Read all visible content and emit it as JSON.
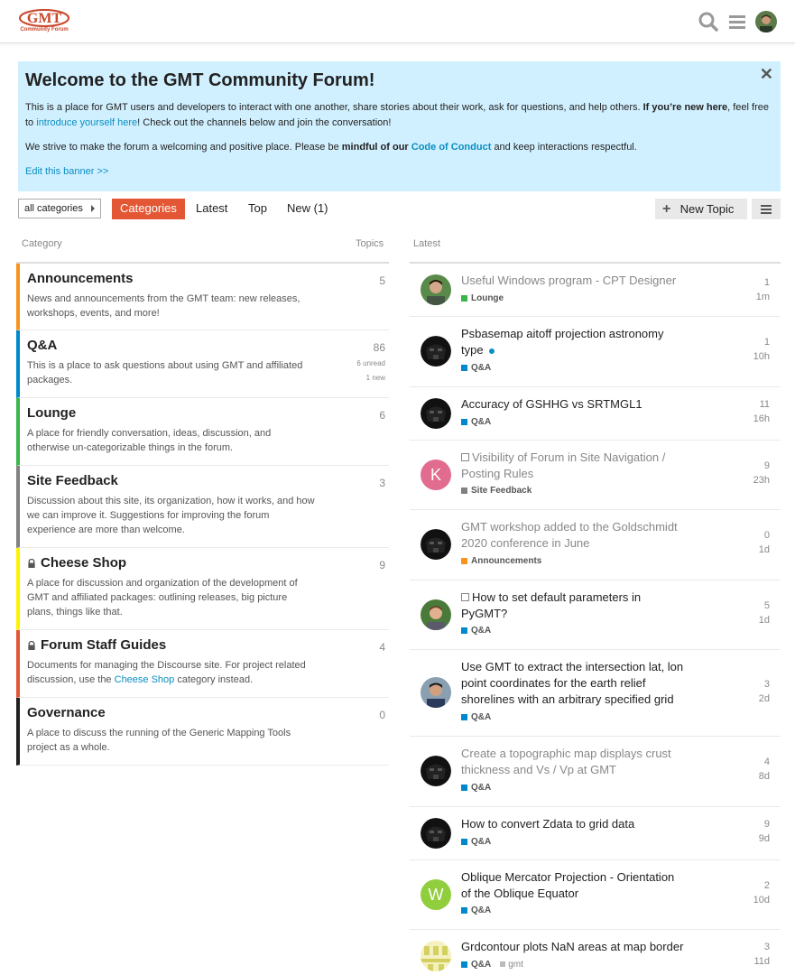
{
  "header": {
    "logo_text": "GMT",
    "logo_sub": "Community Forum"
  },
  "banner": {
    "title": "Welcome to the GMT Community Forum!",
    "p1_a": "This is a place for GMT users and developers to interact with one another, share stories about their work, ask for questions, and help others.",
    "p1_bold": "If you’re new here",
    "p1_b": ", feel free to",
    "p1_link": "introduce yourself here",
    "p1_c": "! Check out the channels below and join the conversation!",
    "p2_a": "We strive to make the forum a welcoming and positive place. Please be",
    "p2_bold": "mindful of our",
    "p2_link": "Code of Conduct",
    "p2_b": "and keep interactions respectful.",
    "edit_link": "Edit this banner >>",
    "close": "✕"
  },
  "nav": {
    "dropdown": "all categories",
    "categories": "Categories",
    "latest": "Latest",
    "top": "Top",
    "new": "New (1)",
    "new_topic": "New Topic"
  },
  "columns": {
    "category": "Category",
    "topics": "Topics",
    "latest": "Latest"
  },
  "categories": [
    {
      "name": "Announcements",
      "desc": "News and announcements from the GMT team: new releases, workshops, events, and more!",
      "count": "5",
      "color": "#f7941d"
    },
    {
      "name": "Q&A",
      "desc": "This is a place to ask questions about using GMT and affiliated packages.",
      "count": "86",
      "unread": "6 unread",
      "new": "1 new",
      "color": "#0088cc"
    },
    {
      "name": "Lounge",
      "desc": "A place for friendly conversation, ideas, discussion, and otherwise un-categorizable things in the forum.",
      "count": "6",
      "color": "#3ab54a"
    },
    {
      "name": "Site Feedback",
      "desc": "Discussion about this site, its organization, how it works, and how we can improve it. Suggestions for improving the forum experience are more than welcome.",
      "count": "3",
      "color": "#808281"
    },
    {
      "name": "Cheese Shop",
      "desc": "A place for discussion and organization of the development of GMT and affiliated packages: outlining releases, big picture plans, things like that.",
      "count": "9",
      "color": "#fff200"
    },
    {
      "name": "Forum Staff Guides",
      "desc_a": "Documents for managing the Discourse site. For project related discussion, use the",
      "desc_link": "Cheese Shop",
      "desc_b": "category instead.",
      "count": "4",
      "color": "#e45735"
    },
    {
      "name": "Governance",
      "desc": "A place to discuss the running of the Generic Mapping Tools project as a whole.",
      "count": "0",
      "color": "#231f20"
    }
  ],
  "topics": [
    {
      "title": "Useful Windows program - CPT Designer",
      "cat": "Lounge",
      "cat_color": "#3ab54a",
      "posts": "1",
      "age": "1m"
    },
    {
      "title": "Psbasemap aitoff projection astronomy type",
      "cat": "Q&A",
      "cat_color": "#0088cc",
      "posts": "1",
      "age": "10h"
    },
    {
      "title": "Accuracy of GSHHG vs SRTMGL1",
      "cat": "Q&A",
      "cat_color": "#0088cc",
      "posts": "11",
      "age": "16h"
    },
    {
      "title": "Visibility of Forum in Site Navigation / Posting Rules",
      "cat": "Site Feedback",
      "cat_color": "#808281",
      "posts": "9",
      "age": "23h",
      "avatar_letter": "K",
      "avatar_color": "#e16c8f"
    },
    {
      "title": "GMT workshop added to the Goldschmidt 2020 conference in June",
      "cat": "Announcements",
      "cat_color": "#f7941d",
      "posts": "0",
      "age": "1d"
    },
    {
      "title": "How to set default parameters in PyGMT?",
      "cat": "Q&A",
      "cat_color": "#0088cc",
      "posts": "5",
      "age": "1d"
    },
    {
      "title": "Use GMT to extract the intersection lat, lon point coordinates for the earth relief shorelines with an arbitrary specified grid",
      "cat": "Q&A",
      "cat_color": "#0088cc",
      "posts": "3",
      "age": "2d"
    },
    {
      "title": "Create a topographic map displays crust thickness and Vs / Vp at GMT",
      "cat": "Q&A",
      "cat_color": "#0088cc",
      "posts": "4",
      "age": "8d"
    },
    {
      "title": "How to convert Zdata to grid data",
      "cat": "Q&A",
      "cat_color": "#0088cc",
      "posts": "9",
      "age": "9d"
    },
    {
      "title": "Oblique Mercator Projection - Orientation of the Oblique Equator",
      "cat": "Q&A",
      "cat_color": "#0088cc",
      "posts": "2",
      "age": "10d",
      "avatar_letter": "W",
      "avatar_color": "#91ce3e"
    },
    {
      "title": "Grdcontour plots NaN areas at map border",
      "cat": "Q&A",
      "cat_color": "#0088cc",
      "tag": "gmt",
      "posts": "3",
      "age": "11d"
    }
  ]
}
